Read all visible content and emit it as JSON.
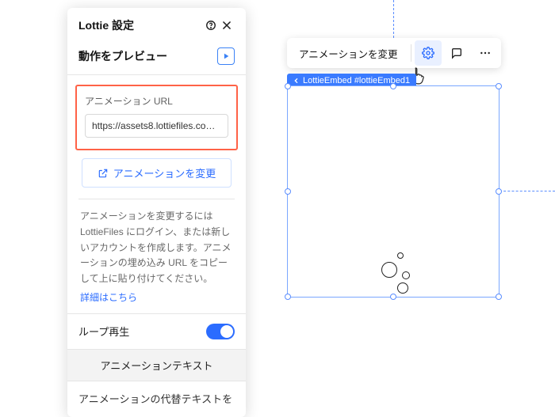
{
  "panel": {
    "title": "Lottie 設定",
    "preview_label": "動作をプレビュー",
    "url_field_label": "アニメーション URL",
    "url_value": "https://assets8.lottiefiles.com/p...",
    "change_button_label": "アニメーションを変更",
    "help_text": "アニメーションを変更するには LottieFiles にログイン、または新しいアカウントを作成します。アニメーションの埋め込み URL をコピーして上に貼り付けてください。",
    "help_link_label": "詳細はこちら",
    "loop_label": "ループ再生",
    "loop_enabled": true,
    "section_title": "アニメーションテキスト",
    "alt_text_label": "アニメーションの代替テキストを"
  },
  "toolbar": {
    "change_label": "アニメーションを変更"
  },
  "tag": {
    "label": "LottieEmbed #lottieEmbed1"
  },
  "colors": {
    "accent": "#2b6cff",
    "highlight_border": "#ff6247",
    "selection_border": "#7aa7ff"
  }
}
